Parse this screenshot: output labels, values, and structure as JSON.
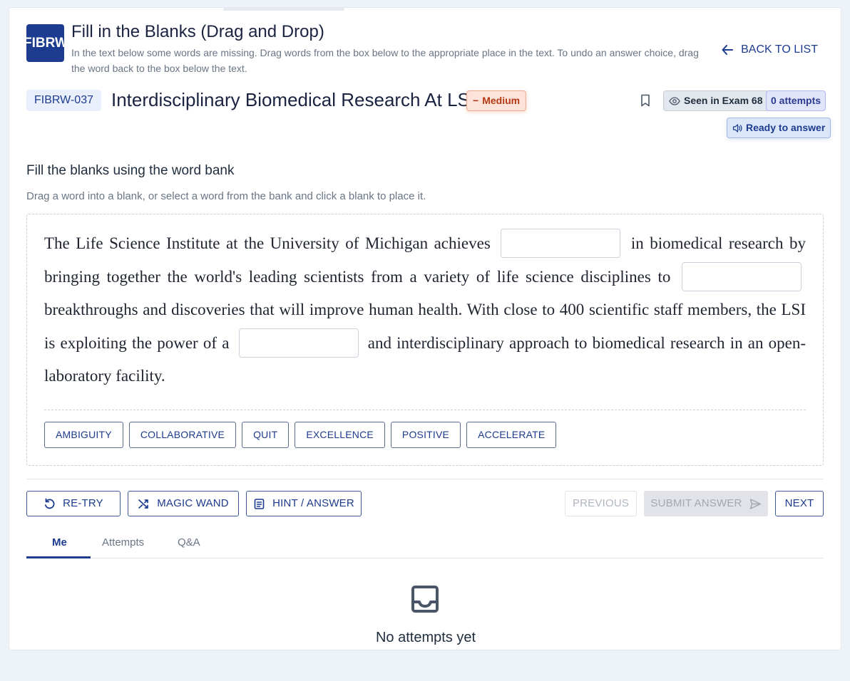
{
  "header": {
    "logo_text": "FIBRW",
    "title": "Fill in the Blanks (Drag and Drop)",
    "description": "In the text below some words are missing. Drag words from the box below to the appropriate place in the text. To undo an answer choice, drag the word back to the box below the text.",
    "back_label": "BACK TO LIST"
  },
  "question": {
    "code": "FIBRW-037",
    "title": "Interdisciplinary Biomedical Research At LSI",
    "difficulty": "Medium",
    "seen_label": "Seen in Exam 68",
    "attempts_label": "0 attempts",
    "status_label": "Ready to answer"
  },
  "instructions": {
    "title": "Fill the blanks using the word bank",
    "subtitle": "Drag a word into a blank, or select a word from the bank and click a blank to place it."
  },
  "passage": {
    "segments": [
      "The Life Science Institute at the University of Michigan achieves",
      "in biomedical research by bringing together the world's leading scientists from a variety of life science disciplines to",
      "breakthroughs and discoveries that will improve human health. With close to 400 scientific staff members, the LSI is exploiting the power of a",
      "and interdisciplinary approach to biomedical research in an open-laboratory facility."
    ]
  },
  "word_bank": [
    "AMBIGUITY",
    "COLLABORATIVE",
    "QUIT",
    "EXCELLENCE",
    "POSITIVE",
    "ACCELERATE"
  ],
  "actions": {
    "retry": "RE-TRY",
    "magic_wand": "MAGIC WAND",
    "hint": "HINT / ANSWER",
    "previous": "PREVIOUS",
    "submit": "SUBMIT ANSWER",
    "next": "NEXT"
  },
  "tabs": [
    "Me",
    "Attempts",
    "Q&A"
  ],
  "empty_state": "No attempts yet",
  "colors": {
    "primary": "#1d3b8f",
    "background": "#eef2f9",
    "difficulty_bg": "#fde3d9",
    "difficulty_text": "#b33a15"
  }
}
